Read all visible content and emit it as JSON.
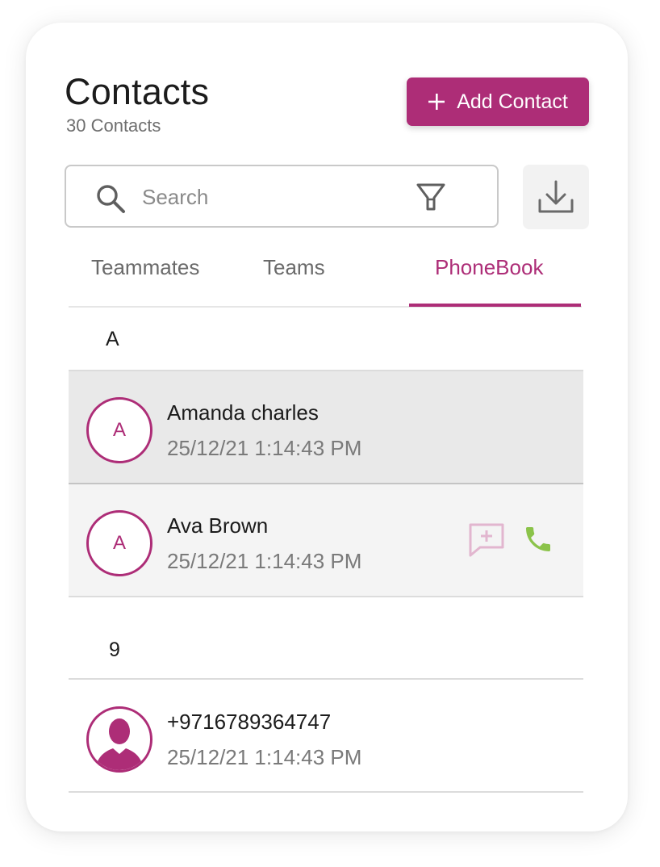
{
  "header": {
    "title": "Contacts",
    "subtitle": "30 Contacts",
    "add_button_label": "Add Contact"
  },
  "search": {
    "placeholder": "Search",
    "value": ""
  },
  "tabs": [
    {
      "label": "Teammates",
      "active": false
    },
    {
      "label": "Teams",
      "active": false
    },
    {
      "label": "PhoneBook",
      "active": true
    }
  ],
  "sections": [
    {
      "letter": "A",
      "contacts": [
        {
          "initial": "A",
          "name": "Amanda charles",
          "timestamp": "25/12/21 1:14:43 PM",
          "state": "selected"
        },
        {
          "initial": "A",
          "name": "Ava Brown",
          "timestamp": "25/12/21 1:14:43 PM",
          "state": "hover",
          "actions": [
            "message-add-icon",
            "phone-icon"
          ]
        }
      ]
    },
    {
      "letter": "9",
      "contacts": [
        {
          "initial": "",
          "avatar": "person-silhouette-icon",
          "name": "+9716789364747",
          "timestamp": "25/12/21 1:14:43 PM",
          "state": "normal"
        }
      ]
    }
  ],
  "colors": {
    "brand": "#ad2d77",
    "selected_row": "#e9e9e9",
    "hover_row": "#f4f4f4",
    "phone_green": "#8bc34a",
    "message_pink": "#e2b6cf"
  }
}
